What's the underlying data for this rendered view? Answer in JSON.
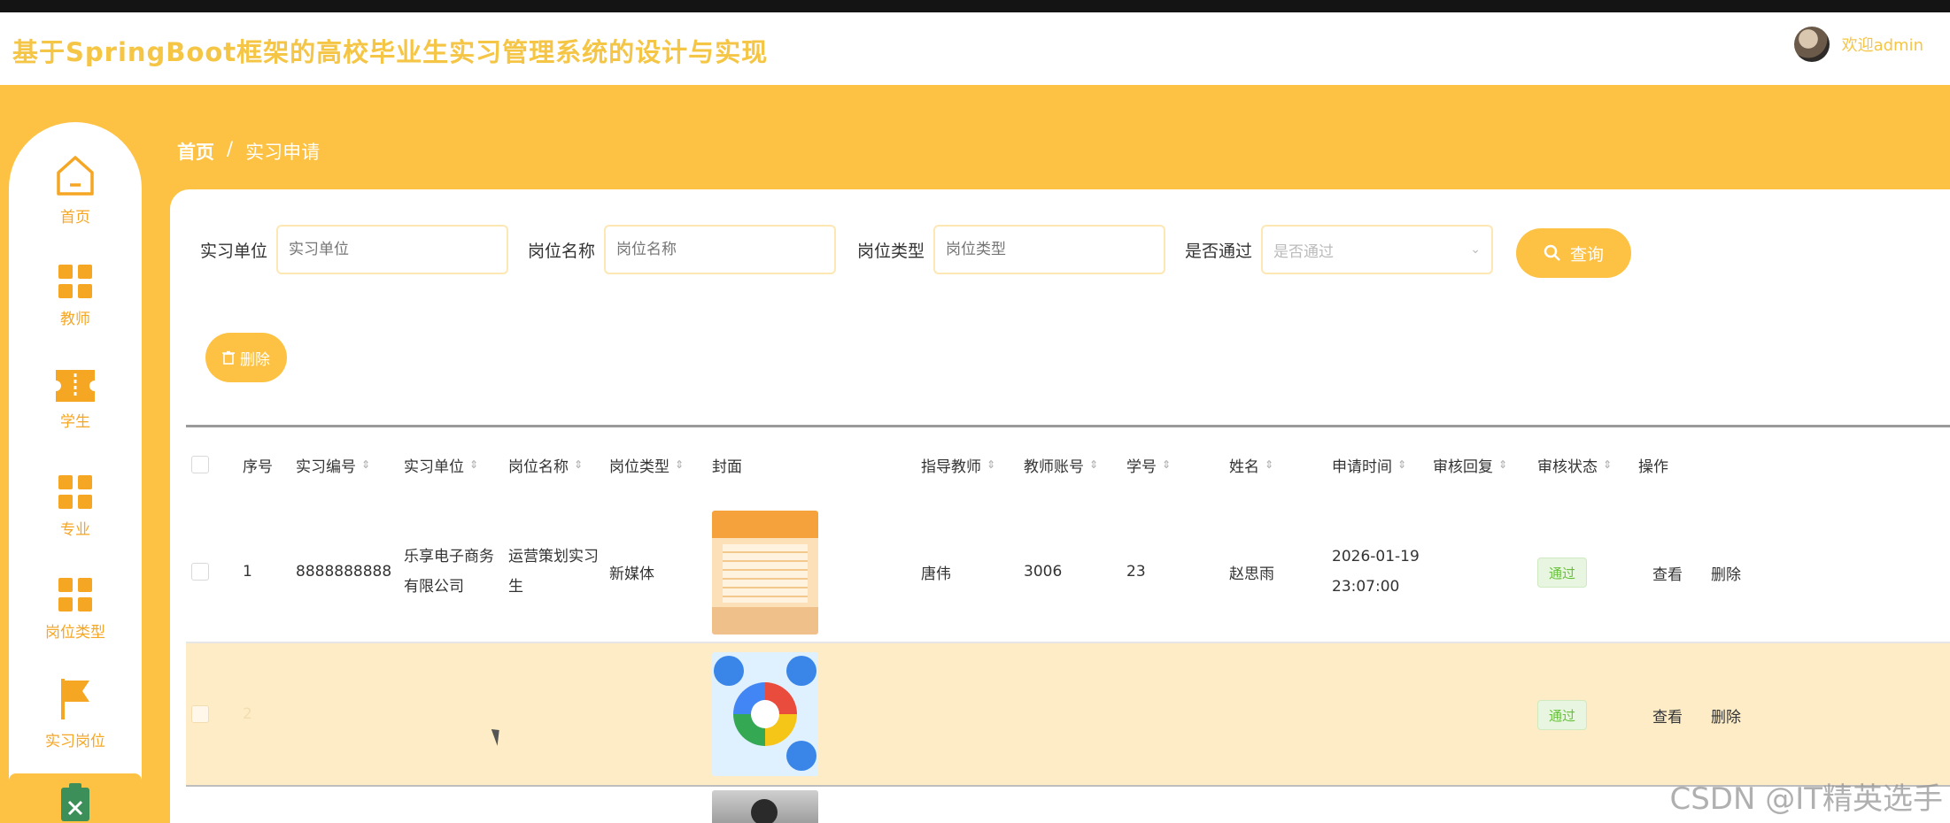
{
  "header": {
    "title": "基于SpringBoot框架的高校毕业生实习管理系统的设计与实现",
    "user_name": "欢迎admin"
  },
  "sidebar": {
    "items": [
      {
        "label": "首页",
        "icon": "home-icon"
      },
      {
        "label": "教师",
        "icon": "grid-icon"
      },
      {
        "label": "学生",
        "icon": "ticket-icon"
      },
      {
        "label": "专业",
        "icon": "grid-icon"
      },
      {
        "label": "岗位类型",
        "icon": "grid-icon"
      },
      {
        "label": "实习岗位",
        "icon": "flag-icon"
      },
      {
        "label": "",
        "icon": "clipboard-icon",
        "active": true
      }
    ]
  },
  "breadcrumb": {
    "home": "首页",
    "separator": "/",
    "current": "实习申请"
  },
  "filters": {
    "unit_label": "实习单位",
    "unit_placeholder": "实习单位",
    "position_label": "岗位名称",
    "position_placeholder": "岗位名称",
    "type_label": "岗位类型",
    "type_placeholder": "岗位类型",
    "pass_label": "是否通过",
    "pass_placeholder": "是否通过",
    "search_button": "查询"
  },
  "toolbar": {
    "delete_button": "删除"
  },
  "table": {
    "columns": [
      "序号",
      "实习编号",
      "实习单位",
      "岗位名称",
      "岗位类型",
      "封面",
      "指导教师",
      "教师账号",
      "学号",
      "姓名",
      "申请时间",
      "审核回复",
      "审核状态",
      "操作"
    ],
    "rows": [
      {
        "index": "1",
        "code": "8888888888",
        "unit": "乐享电子商务有限公司",
        "position": "运营策划实习生",
        "type": "新媒体",
        "teacher": "唐伟",
        "teacher_account": "3006",
        "student_no": "23",
        "name": "赵思雨",
        "time": "2026-01-19 23:07:00",
        "reply": "",
        "status": "通过",
        "view": "查看",
        "delete": "删除"
      },
      {
        "index": "2",
        "code": "",
        "unit": "",
        "position": "",
        "type": "",
        "teacher": "",
        "teacher_account": "",
        "student_no": "",
        "name": "",
        "time": "",
        "reply": "",
        "status": "通过",
        "view": "查看",
        "delete": "删除"
      }
    ]
  },
  "watermark": "CSDN @IT精英选手",
  "colors": {
    "accent": "#fdc243",
    "title": "#f5c545",
    "success": "#67c23a",
    "selected_row": "#fdecc5"
  }
}
